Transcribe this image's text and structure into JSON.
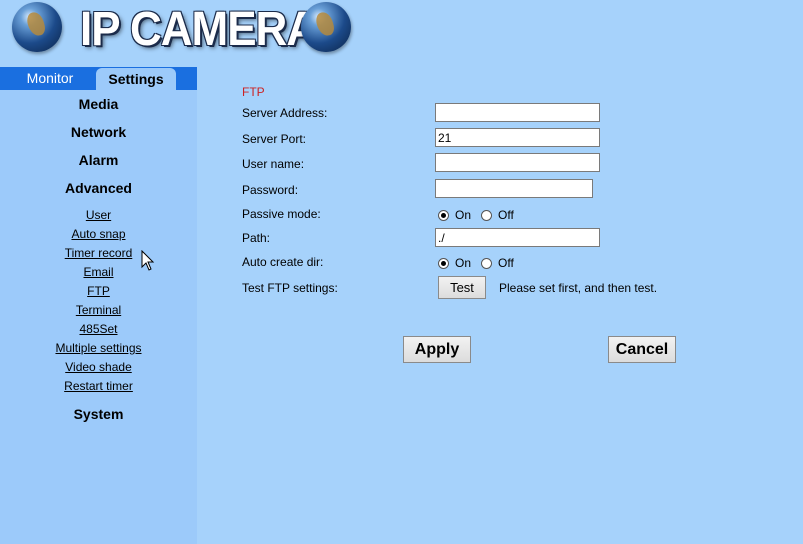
{
  "header": {
    "title": "IP CAMERA"
  },
  "tabs": {
    "monitor": "Monitor",
    "settings": "Settings"
  },
  "sidebar": {
    "sections": {
      "media": "Media",
      "network": "Network",
      "alarm": "Alarm",
      "advanced": "Advanced",
      "system": "System"
    },
    "advanced_links": [
      "User",
      "Auto snap",
      "Timer record",
      "Email",
      "FTP",
      "Terminal",
      "485Set",
      "Multiple settings",
      "Video shade",
      "Restart timer"
    ]
  },
  "ftp": {
    "title": "FTP",
    "labels": {
      "server_address": "Server Address:",
      "server_port": "Server Port:",
      "user_name": "User name:",
      "password": "Password:",
      "passive_mode": "Passive mode:",
      "path": "Path:",
      "auto_create_dir": "Auto create dir:",
      "test_settings": "Test FTP settings:"
    },
    "values": {
      "server_address": "",
      "server_port": "21",
      "user_name": "",
      "password": "",
      "path": "./"
    },
    "passive_mode": {
      "on": "On",
      "off": "Off",
      "selected": "On"
    },
    "auto_create_dir": {
      "on": "On",
      "off": "Off",
      "selected": "On"
    },
    "test_button": "Test",
    "test_hint": "Please set first, and then test."
  },
  "actions": {
    "apply": "Apply",
    "cancel": "Cancel"
  },
  "colors": {
    "tab_bar": "#1a6fe0",
    "section_title": "#cc2222",
    "background": "#a6d2fb"
  }
}
